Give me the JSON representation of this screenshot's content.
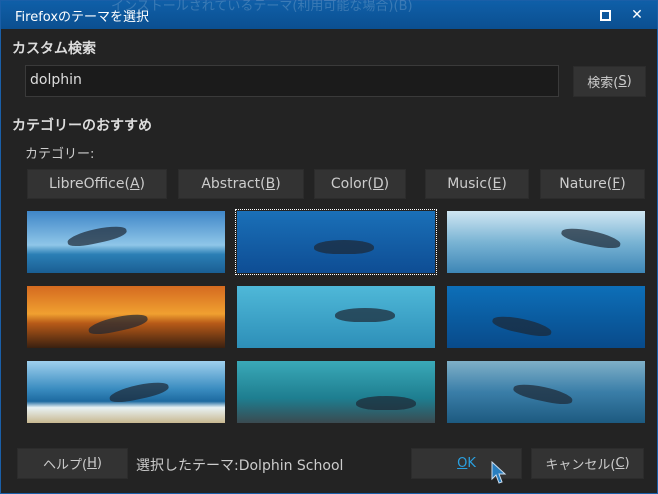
{
  "window": {
    "title": "Firefoxのテーマを選択",
    "background_text": "インストールされているテーマ(利用可能な場合)(B)",
    "maximize_icon": "square",
    "close_icon": "x"
  },
  "search": {
    "heading": "カスタム検索",
    "value": "dolphin",
    "button": "検索(",
    "button_key": "S",
    "button_end": ")"
  },
  "categories": {
    "heading": "カテゴリーのおすすめ",
    "label": "カテゴリー:",
    "buttons": [
      {
        "label": "LibreOffice(",
        "key": "A"
      },
      {
        "label": "Abstract(",
        "key": "B"
      },
      {
        "label": "Color(",
        "key": "D"
      },
      {
        "label": "Music(",
        "key": "E"
      },
      {
        "label": "Nature(",
        "key": "F"
      }
    ]
  },
  "themes": [
    {
      "bg": "linear-gradient(#3f86c8,#8fc6e8 55%,#2b7fb5 70%,#1a5e93)",
      "selected": false
    },
    {
      "bg": "linear-gradient(#1a70b8,#0e4d94)",
      "selected": true
    },
    {
      "bg": "linear-gradient(#cfe6f2,#7ab4d4 50%,#3d86b6)",
      "selected": false
    },
    {
      "bg": "linear-gradient(#d46a20,#f0a030 45%,#b85a18 60%,#3a2010)",
      "selected": false
    },
    {
      "bg": "linear-gradient(#4fb8d8,#2d8fb8)",
      "selected": false
    },
    {
      "bg": "linear-gradient(#0d6fb8,#084a8a)",
      "selected": false
    },
    {
      "bg": "linear-gradient(#9fd0ee,#3a8cc0 45%,#1d6aa0 65%,#e8f2f4 75%,#c8b890)",
      "selected": false
    },
    {
      "bg": "linear-gradient(#3aa9b8,#1e7e90 60%,#3a4a50)",
      "selected": false
    },
    {
      "bg": "linear-gradient(#7fb0c8,#3a7ea8 50%,#1d5a80)",
      "selected": false
    }
  ],
  "footer": {
    "help": "ヘルプ(",
    "help_key": "H",
    "help_end": ")",
    "selected_label": "選択したテーマ:Dolphin School",
    "ok_key": "O",
    "ok": "K",
    "cancel": "キャンセル(",
    "cancel_key": "C",
    "cancel_end": ")"
  },
  "colors": {
    "titlebar": "#0f5fa8",
    "accent": "#2aa0e0",
    "background": "#232323"
  }
}
